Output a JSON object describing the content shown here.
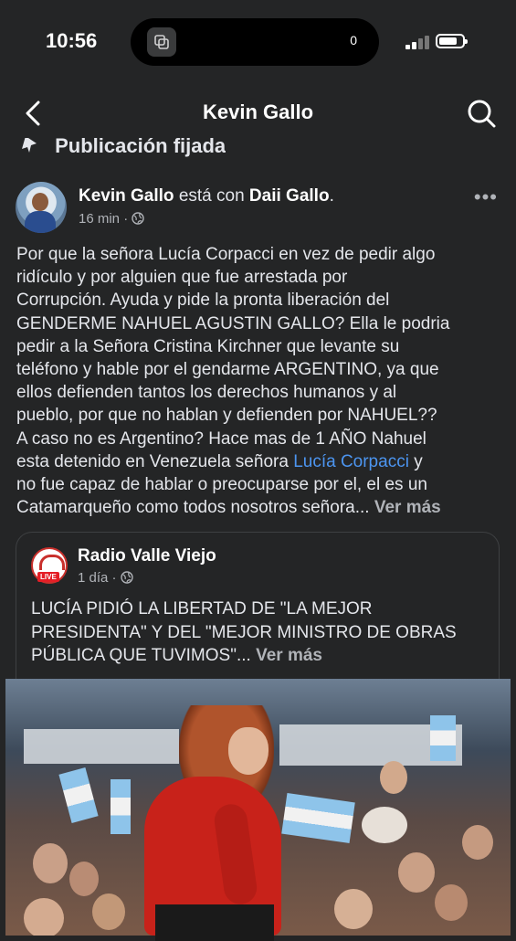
{
  "status": {
    "time": "10:56",
    "island_count": "0",
    "battery_level": 0.8
  },
  "header": {
    "title": "Kevin Gallo",
    "back_icon": "chevron-left-icon",
    "search_icon": "search-icon"
  },
  "pinned_label": "Publicación fijada",
  "post": {
    "author": "Kevin Gallo",
    "with_text": "está con",
    "tagged": "Daii Gallo",
    "tagged_suffix": ".",
    "time": "16 min",
    "sep": "·",
    "lines": [
      "Por que la señora Lucía Corpacci en vez de pedir algo",
      "ridículo y por alguien que fue arrestada por",
      "Corrupción. Ayuda y pide la pronta  liberación del",
      "GENDERME NAHUEL AGUSTIN GALLO? Ella le podria",
      "pedir a la Señora Cristina Kirchner que levante su",
      "teléfono y hable por el gendarme ARGENTINO, ya que",
      "ellos defienden tantos los derechos humanos y al",
      "pueblo, por que no hablan y defienden por NAHUEL??",
      "A caso no es Argentino? Hace mas de 1 AÑO Nahuel"
    ],
    "line9_prefix": "esta detenido en Venezuela señora ",
    "line9_link": "Lucía Corpacci",
    "line9_suffix": " y",
    "line10": "no fue capaz de hablar o preocuparse por el, el es un",
    "line11": "Catamarqueño como todos nosotros señora... ",
    "see_more": "Ver más"
  },
  "shared": {
    "name": "Radio Valle Viejo",
    "live_badge": "LIVE",
    "time": "1 día",
    "sep": "·",
    "lines": [
      "LUCÍA PIDIÓ LA LIBERTAD DE \"LA MEJOR",
      "PRESIDENTA\" Y DEL \"MEJOR MINISTRO DE OBRAS"
    ],
    "line3": "PÚBLICA QUE TUVIMOS\"... ",
    "see_more": "Ver más"
  },
  "colors": {
    "background": "#242526",
    "link": "#4c95f0",
    "muted": "#b0b3b8",
    "jacket": "#c8221a"
  }
}
